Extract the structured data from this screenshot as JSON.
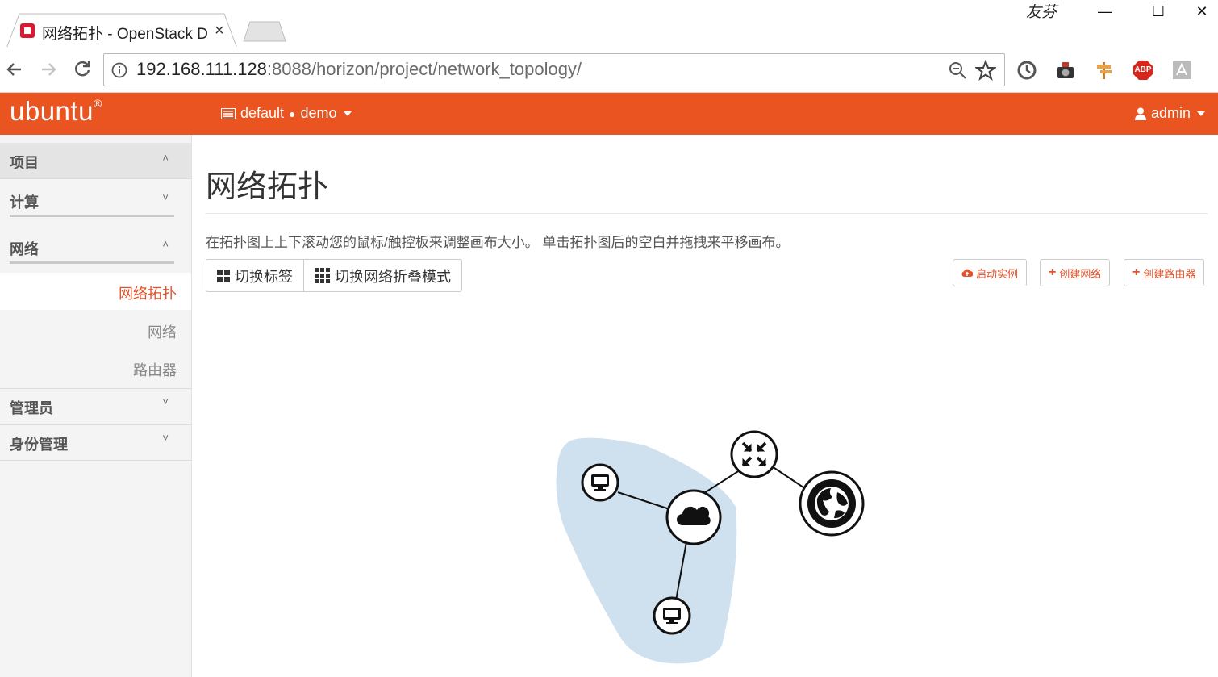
{
  "browser": {
    "tab_title": "网络拓扑 - OpenStack D",
    "tab_close": "×",
    "profile_name": "友芬",
    "window_controls": {
      "minimize": "—",
      "maximize": "☐",
      "close": "✕"
    },
    "url_host": "192.168.111.128",
    "url_rest": ":8088/horizon/project/network_topology/",
    "extensions": [
      "sync-icon",
      "camera-icon",
      "signpost-icon",
      "adblock-icon",
      "pdf-icon"
    ],
    "adblock_label": "ABP"
  },
  "header": {
    "logo": "ubuntu",
    "logo_mark": "®",
    "project_domain": "default",
    "project_sep": "●",
    "project_name": "demo",
    "user": "admin",
    "brand_color": "#e95420"
  },
  "sidebar": {
    "sections": {
      "project": {
        "label": "项目",
        "chevron": "˄"
      },
      "compute": {
        "label": "计算",
        "chevron": "˅"
      },
      "network": {
        "label": "网络",
        "chevron": "˄"
      },
      "admin": {
        "label": "管理员",
        "chevron": "˅"
      },
      "identity": {
        "label": "身份管理",
        "chevron": "˅"
      }
    },
    "network_items": {
      "topology": "网络拓扑",
      "networks": "网络",
      "routers": "路由器"
    }
  },
  "main": {
    "title": "网络拓扑",
    "help_text": "在拓扑图上上下滚动您的鼠标/触控板来调整画布大小。 单击拓扑图后的空白并拖拽来平移画布。",
    "toggle_labels": "切换标签",
    "toggle_collapse": "切换网络折叠模式",
    "launch_instance": "启动实例",
    "create_network": "创建网络",
    "create_router": "创建路由器",
    "network_fill": "#cfe0ee"
  }
}
